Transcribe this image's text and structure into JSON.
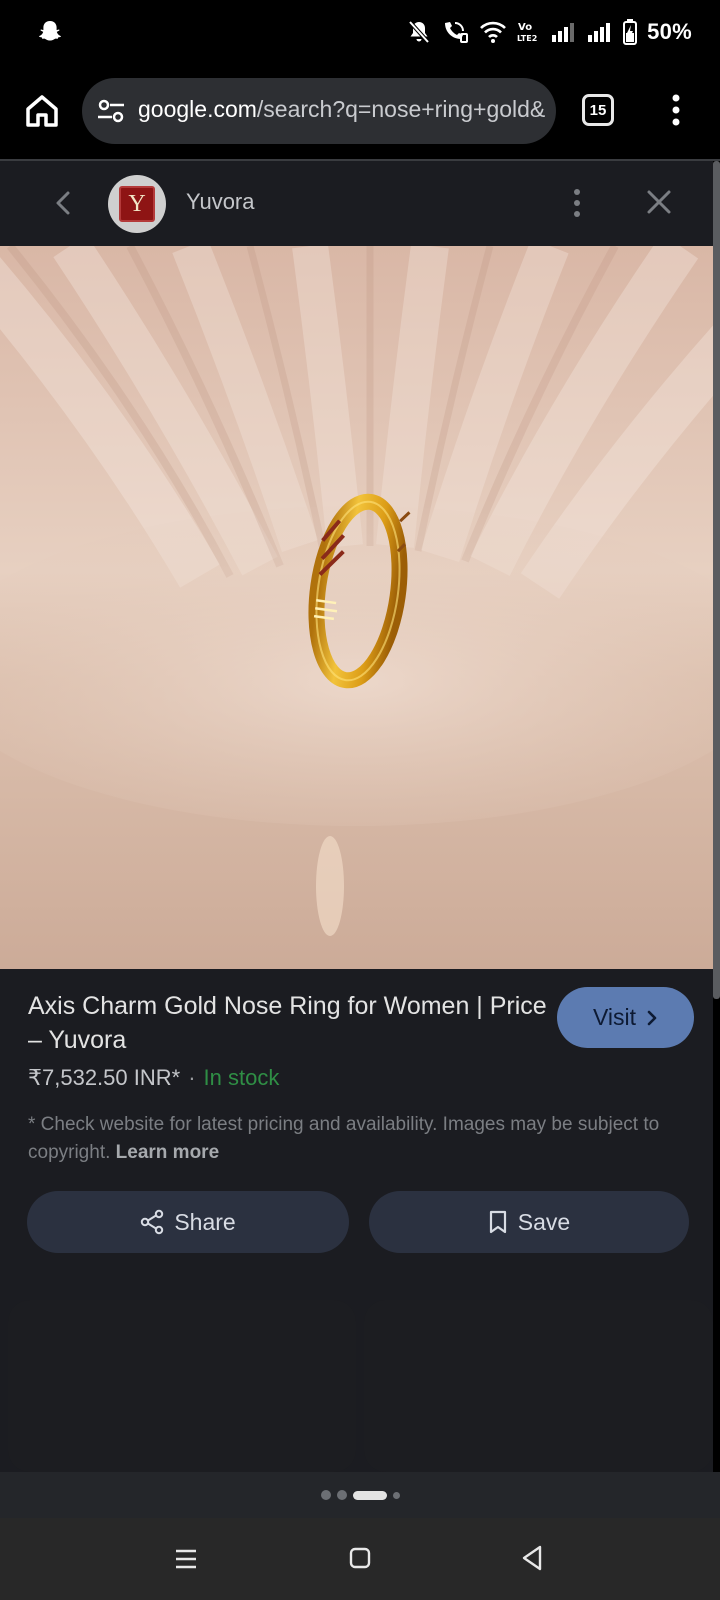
{
  "status_bar": {
    "battery_percent": "50%",
    "icons": [
      "snapchat-icon",
      "mute-icon",
      "wifi-calling-icon",
      "wifi-icon",
      "volte-icon",
      "signal-icon",
      "signal-icon",
      "battery-charging-icon"
    ]
  },
  "browser": {
    "url_host": "google.com",
    "url_path": "/search?q=nose+ring+gold&",
    "tab_count": "15"
  },
  "panel": {
    "source_name": "Yuvora",
    "logo_letter": "Y"
  },
  "product": {
    "title": "Axis Charm Gold Nose Ring for Women | Price – Yuvora",
    "price": "₹7,532.50 INR*",
    "separator": "·",
    "stock": "In stock",
    "disclaimer": "* Check website for latest pricing and availability. Images may be subject to copyright.",
    "learn_more": "Learn more",
    "visit_label": "Visit",
    "share_label": "Share",
    "save_label": "Save"
  },
  "pager": {
    "page_count": 4,
    "active_page": 3
  },
  "colors": {
    "accent_visit": "#5c7bb1",
    "in_stock": "#2f8e45",
    "panel_bg": "#1b1c21",
    "button_bg": "#2b3140"
  }
}
